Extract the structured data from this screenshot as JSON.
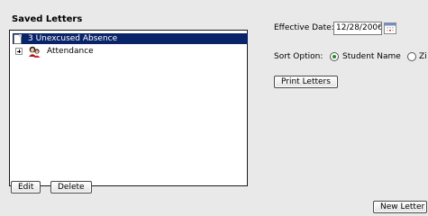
{
  "saved_letters": {
    "title": "Saved Letters",
    "items": [
      {
        "label": "3 Unexcused Absence",
        "selected": true,
        "icon": "document-icon"
      },
      {
        "label": "Attendance",
        "selected": false,
        "icon": "student-icon",
        "expandable": true
      }
    ],
    "edit_label": "Edit",
    "delete_label": "Delete"
  },
  "options": {
    "effective_date_label": "Effective Date:",
    "effective_date_value": "12/28/2006",
    "sort_option_label": "Sort Option:",
    "sort_options": [
      {
        "label": "Student Name",
        "selected": true
      },
      {
        "label": "Zi",
        "selected": false
      }
    ],
    "print_letters_label": "Print Letters"
  },
  "footer": {
    "new_letter_label": "New Letter"
  },
  "colors": {
    "selection": "#0a246a",
    "background": "#e9e9e9"
  }
}
